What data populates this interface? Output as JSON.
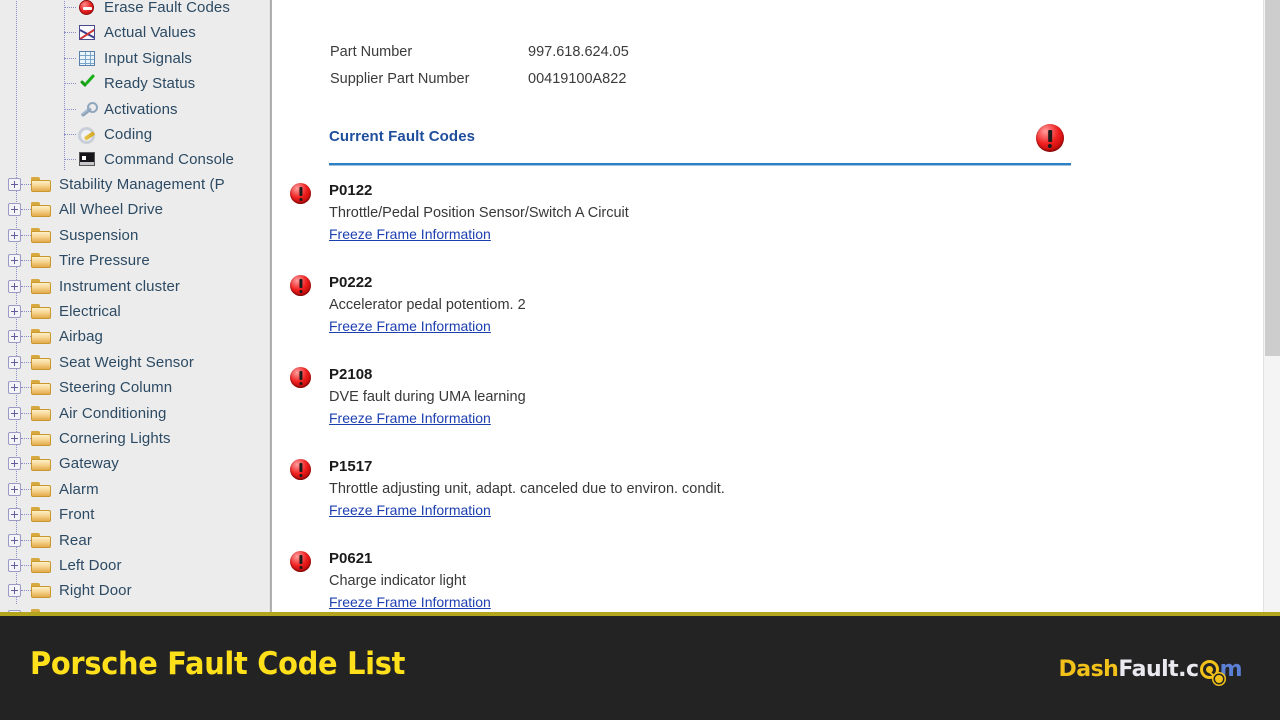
{
  "sidebar": {
    "child_items": [
      {
        "label": "Erase Fault Codes",
        "icon": "erase-fault-codes-icon"
      },
      {
        "label": "Actual Values",
        "icon": "chart-icon"
      },
      {
        "label": "Input Signals",
        "icon": "table-icon"
      },
      {
        "label": "Ready Status",
        "icon": "green-check-icon"
      },
      {
        "label": "Activations",
        "icon": "wrench-icon"
      },
      {
        "label": "Coding",
        "icon": "coding-gear-icon"
      },
      {
        "label": "Command Console",
        "icon": "console-icon"
      }
    ],
    "folder_items": [
      {
        "label": "Stability Management (P"
      },
      {
        "label": "All Wheel Drive"
      },
      {
        "label": "Suspension"
      },
      {
        "label": "Tire Pressure"
      },
      {
        "label": "Instrument cluster"
      },
      {
        "label": "Electrical"
      },
      {
        "label": "Airbag"
      },
      {
        "label": "Seat Weight Sensor"
      },
      {
        "label": "Steering Column"
      },
      {
        "label": "Air Conditioning"
      },
      {
        "label": "Cornering Lights"
      },
      {
        "label": "Gateway"
      },
      {
        "label": "Alarm"
      },
      {
        "label": "Front"
      },
      {
        "label": "Rear"
      },
      {
        "label": "Left Door"
      },
      {
        "label": "Right Door"
      }
    ]
  },
  "main": {
    "part_info": [
      {
        "key": "Part Number",
        "value": "997.618.624.05"
      },
      {
        "key": "Supplier Part Number",
        "value": "00419100A822"
      }
    ],
    "section_title": "Current Fault Codes",
    "freeze_frame_label": "Freeze Frame Information",
    "faults": [
      {
        "code": "P0122",
        "description": "Throttle/Pedal Position Sensor/Switch A Circuit"
      },
      {
        "code": "P0222",
        "description": "Accelerator pedal potentiom. 2"
      },
      {
        "code": "P2108",
        "description": "DVE fault during UMA learning"
      },
      {
        "code": "P1517",
        "description": "Throttle adjusting unit, adapt. canceled due to environ. condit."
      },
      {
        "code": "P0621",
        "description": "Charge indicator light"
      }
    ]
  },
  "banner": {
    "title": "Porsche Fault Code List",
    "logo": {
      "part1": "Dash",
      "part2": "Fault.c",
      "part3": "m"
    }
  },
  "colors": {
    "banner_bg": "#232323",
    "banner_accent": "#b3a61e",
    "title_yellow": "#ffe01b",
    "section_blue": "#1f4e9c",
    "rule_blue": "#2f7fc4",
    "link_blue": "#1c3fb0",
    "fault_red": "#f02020",
    "tree_text": "#2c4a63"
  }
}
